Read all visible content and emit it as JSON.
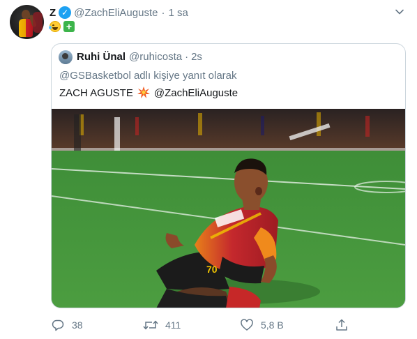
{
  "tweet": {
    "name": "Z",
    "verified_mark": "✓",
    "handle": "@ZachEliAuguste",
    "separator": "·",
    "time": "1 sa",
    "emoji_icons": [
      "face-with-tears-of-joy-icon",
      "green-plus-icon"
    ],
    "plus_glyph": "+"
  },
  "quoted": {
    "name": "Ruhi Ünal",
    "handle": "@ruhicosta",
    "separator": "·",
    "time": "2s",
    "reply_context": "@GSBasketbol adlı kişiye yanıt olarak",
    "text_main": "ZACH AGUSTE",
    "text_icon": "collision-icon",
    "text_mention": "@ZachEliAuguste",
    "photo_description_icon": "football-celebration-photo"
  },
  "actions": {
    "reply_count": "38",
    "retweet_count": "411",
    "like_count": "5,8 B"
  },
  "colors": {
    "accent": "#1da1f2",
    "secondary_text": "#657786",
    "border": "#ccd6dd",
    "pitch_green": "#3f8f3a",
    "jersey_red": "#c7262b",
    "jersey_orange": "#f08a1c"
  }
}
